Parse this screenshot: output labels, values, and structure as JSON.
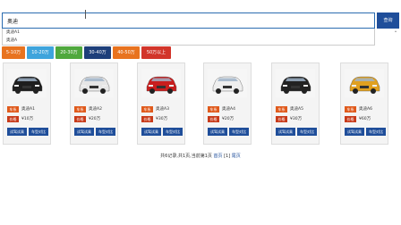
{
  "search": {
    "value": "奥迪",
    "button_label": "查询"
  },
  "suggestions": [
    "奥迪A1",
    "奥迪A"
  ],
  "filters": [
    {
      "label": "5-10万",
      "color": "#e8731f"
    },
    {
      "label": "10-20万",
      "color": "#3ea4dc"
    },
    {
      "label": "20-30万",
      "color": "#4fa83d"
    },
    {
      "label": "30-40万",
      "color": "#1e3f7a"
    },
    {
      "label": "40-50万",
      "color": "#e8731f"
    },
    {
      "label": "50万以上",
      "color": "#d2352a"
    }
  ],
  "cards": [
    {
      "brand_tag": "车系",
      "model": "奥迪A1",
      "price_tag": "价格",
      "price": "¥10万",
      "btn1": "试驾试乘",
      "btn2": "车型对比",
      "car_color": "#1e1e1e"
    },
    {
      "brand_tag": "车系",
      "model": "奥迪A2",
      "price_tag": "价格",
      "price": "¥20万",
      "btn1": "试驾试乘",
      "btn2": "车型对比",
      "car_color": "#e6e6e6"
    },
    {
      "brand_tag": "车系",
      "model": "奥迪A3",
      "price_tag": "价格",
      "price": "¥30万",
      "btn1": "试驾试乘",
      "btn2": "车型对比",
      "car_color": "#c81e1e"
    },
    {
      "brand_tag": "车系",
      "model": "奥迪A4",
      "price_tag": "价格",
      "price": "¥20万",
      "btn1": "试驾试乘",
      "btn2": "车型对比",
      "car_color": "#efefef"
    },
    {
      "brand_tag": "车系",
      "model": "奥迪A5",
      "price_tag": "价格",
      "price": "¥30万",
      "btn1": "试驾试乘",
      "btn2": "车型对比",
      "car_color": "#222222"
    },
    {
      "brand_tag": "车系",
      "model": "奥迪A6",
      "price_tag": "价格",
      "price": "¥60万",
      "btn1": "试驾试乘",
      "btn2": "车型对比",
      "car_color": "#e0a020"
    }
  ],
  "pager": {
    "summary": "共6记录,共1页,当前第1页",
    "first": "首页",
    "page": "[1]",
    "last": "尾页"
  }
}
